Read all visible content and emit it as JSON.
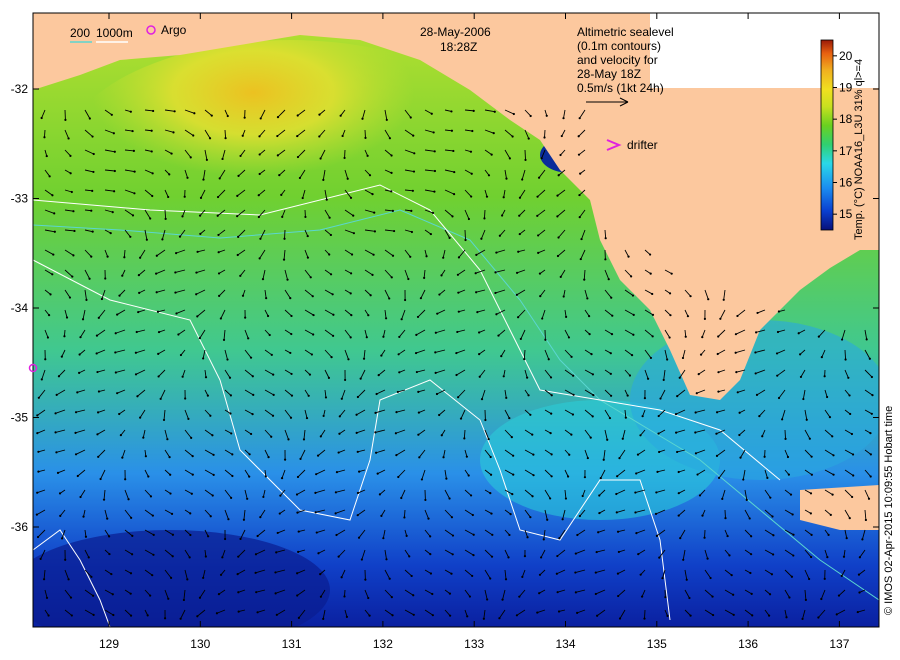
{
  "map": {
    "date": "28-May-2006",
    "time": "18:28Z",
    "depth_legend": {
      "shallow": "200",
      "deep": "1000m",
      "shallow_color": "#5bd6d0",
      "deep_color": "#ffffff"
    },
    "argo_label": "Argo",
    "argo_color": "#e020e0",
    "drifter_label": "drifter",
    "drifter_color": "#e020e0",
    "altimetry_note": [
      "Altimetric sealevel",
      "(0.1m contours)",
      "and velocity for",
      "28-May 18Z",
      "0.5m/s (1kt 24h)"
    ],
    "land_color": "#fcc89e",
    "x_ticks": [
      "129",
      "130",
      "131",
      "132",
      "133",
      "134",
      "135",
      "136",
      "137"
    ],
    "y_ticks": [
      "-32",
      "-33",
      "-34",
      "-35",
      "-36"
    ]
  },
  "colorbar": {
    "label": "Temp. (°C) NOAA16_L3U 31% ql>=4",
    "ticks": [
      "20",
      "19",
      "18",
      "17",
      "16",
      "15"
    ],
    "range": [
      14.5,
      20.5
    ],
    "colors": [
      "#08107a",
      "#0a3fd0",
      "#1a8cf0",
      "#2ad8e8",
      "#30d070",
      "#6ad020",
      "#c8e020",
      "#f0e020",
      "#f0b020",
      "#e86010",
      "#9a1a08"
    ]
  },
  "footer": {
    "credit": "© IMOS 02-Apr-2015 10:09:55 Hobart time"
  }
}
